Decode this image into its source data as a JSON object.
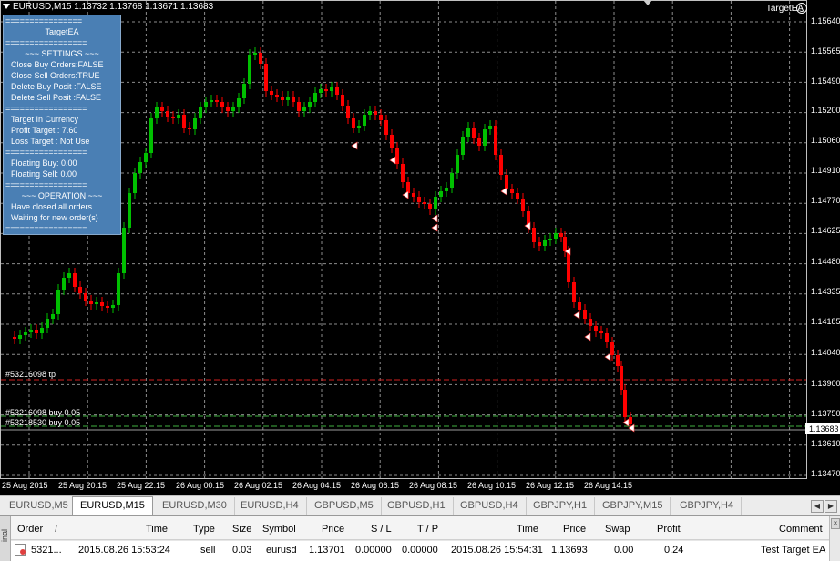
{
  "chart_header": {
    "text": "EURUSD,M15  1.13732 1.13768 1.13671 1.13683"
  },
  "ea": {
    "name": "TargetEA"
  },
  "panel": {
    "lines": [
      "================",
      "TargetEA",
      "=================",
      "~~~ SETTINGS ~~~",
      "Close Buy Orders:FALSE",
      "Close Sell Orders:TRUE",
      "Delete Buy Posit :FALSE",
      "Delete Sell Posit :FALSE",
      "=================",
      "Target In Currency",
      "Profit Target : 7.60",
      "Loss Target  : Not Use",
      "=================",
      "Floating Buy: 0.00",
      "Floating Sell: 0.00",
      "=================",
      "~~~ OPERATION ~~~",
      "Have closed all orders",
      "Waiting for new order(s)",
      "================="
    ]
  },
  "price_axis": [
    "1.15640",
    "1.15565",
    "1.15490",
    "1.15200",
    "1.15060",
    "1.14910",
    "1.14770",
    "1.14625",
    "1.14480",
    "1.14335",
    "1.14185",
    "1.14040",
    "1.13900",
    "1.13750",
    "1.13610",
    "1.13470"
  ],
  "price_current": "1.13683",
  "time_axis": [
    "25 Aug 2015",
    "25 Aug 20:15",
    "25 Aug 22:15",
    "26 Aug 00:15",
    "26 Aug 02:15",
    "26 Aug 04:15",
    "26 Aug 06:15",
    "26 Aug 08:15",
    "26 Aug 10:15",
    "26 Aug 12:15",
    "26 Aug 14:15"
  ],
  "order_lines": [
    {
      "label": "#53216098 tp",
      "color": "#d02020"
    },
    {
      "label": "#53216098 buy 0.05",
      "color": "#40b040"
    },
    {
      "label": "#53218530 buy 0.05",
      "color": "#40b040"
    }
  ],
  "tabs": [
    "EURUSD,M5",
    "EURUSD,M15",
    "EURUSD,M30",
    "EURUSD,H4",
    "GBPUSD,M5",
    "GBPUSD,H1",
    "GBPUSD,H4",
    "GBPJPY,H1",
    "GBPJPY,M15",
    "GBPJPY,H4"
  ],
  "terminal": {
    "side_label": "inal",
    "headers": [
      "Order",
      "/",
      "Time",
      "Type",
      "Size",
      "Symbol",
      "Price",
      "S / L",
      "T / P",
      "Time",
      "Price",
      "Swap",
      "Profit",
      "Comment"
    ],
    "row": [
      "5321...",
      "2015.08.26 15:53:24",
      "sell",
      "0.03",
      "eurusd",
      "1.13701",
      "0.00000",
      "0.00000",
      "2015.08.26 15:54:31",
      "1.13693",
      "0.00",
      "0.24",
      "Test Target EA"
    ]
  },
  "colors": {
    "bull": "#00c000",
    "bear": "#ff0000",
    "panel": "#4a7fb4"
  }
}
